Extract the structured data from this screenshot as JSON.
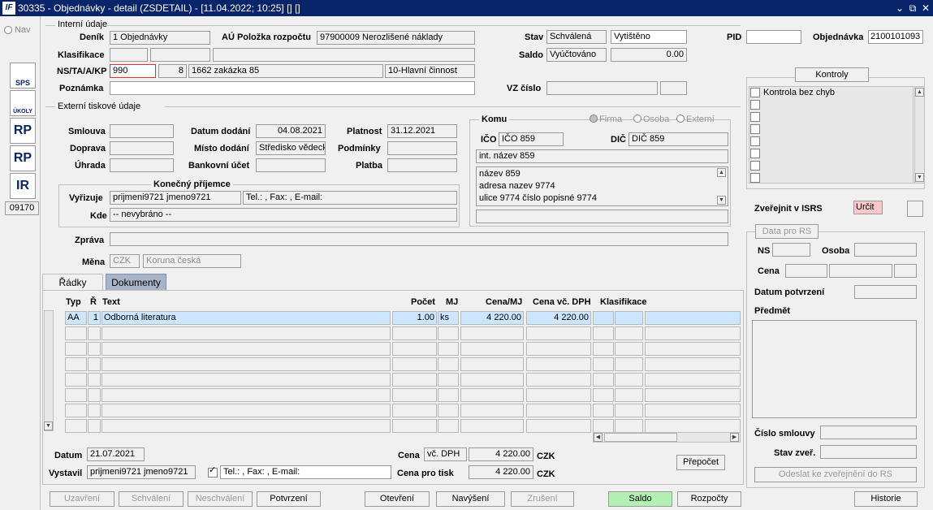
{
  "window": {
    "title": "30335 - Objednávky - detail (ZSDETAIL) - [11.04.2022; 10:25] [] []",
    "logo": "IF",
    "btn_min": "⌄",
    "btn_max": "⧉",
    "btn_close": "✕"
  },
  "nav": {
    "label": "Nav",
    "id_box": "09170",
    "icons": [
      {
        "name": "sps-icon",
        "text": "SPS"
      },
      {
        "name": "ukoly-icon",
        "text": "ÚKOLY"
      },
      {
        "name": "rp-cz-icon",
        "text": "RP"
      },
      {
        "name": "rp-eu-icon",
        "text": "RP"
      },
      {
        "name": "ir-cz-icon",
        "text": "IR"
      }
    ]
  },
  "internal": {
    "section": "Interní údaje",
    "denik_label": "Deník",
    "denik": "1 Objednávky",
    "au_label": "AÚ Položka rozpočtu",
    "au": "97900009 Nerozlišené náklady",
    "klas_label": "Klasifikace",
    "nsta_label": "NS/TA/A/KP",
    "ns": "990",
    "ta": "8",
    "zakazka": "1662 zakázka 85",
    "kp": "10-Hlavní činnost",
    "poznamka_label": "Poznámka",
    "stav_label": "Stav",
    "stav": "Schválená",
    "stav2": "Vytištěno",
    "saldo_label": "Saldo",
    "saldo": "Vyúčtováno",
    "saldo_val": "0.00",
    "vz_label": "VZ číslo",
    "pid_label": "PID",
    "obj_label": "Objednávka",
    "obj": "2100101093"
  },
  "external": {
    "section": "Externí tiskové údaje",
    "smlouva_label": "Smlouva",
    "doprava_label": "Doprava",
    "uhrada_label": "Úhrada",
    "datum_dodani_label": "Datum dodání",
    "datum_dodani": "04.08.2021",
    "misto_label": "Místo dodání",
    "misto": "Středisko vědeck",
    "bank_label": "Bankovní účet",
    "platnost_label": "Platnost",
    "platnost": "31.12.2021",
    "podminky_label": "Podmínky",
    "platba_label": "Platba",
    "prijemce_title": "Konečný příjemce",
    "vyrizuje_label": "Vyřizuje",
    "vyrizuje": "prijmeni9721 jmeno9721",
    "tel": "Tel.: , Fax: , E-mail:",
    "kde_label": "Kde",
    "kde": "-- nevybráno --",
    "zprava_label": "Zpráva",
    "mena_label": "Měna",
    "mena": "CZK",
    "mena_name": "Koruna česká"
  },
  "komu": {
    "title": "Komu",
    "radio_firma": "Firma",
    "radio_osoba": "Osoba",
    "radio_externi": "Externí",
    "ico_label": "IČO",
    "ico": "IČO 859",
    "dic_label": "DIČ",
    "dic": "DIČ 859",
    "int_name": "int. název 859",
    "addr1": "název 859",
    "addr2": "adresa nazev 9774",
    "addr3": "ulice 9774 číslo popisné 9774"
  },
  "kontroly": {
    "title": "Kontroly",
    "item1": "Kontrola bez chyb"
  },
  "isrs": {
    "label": "Zveřejnit v ISRS",
    "value": "Určit",
    "data_rs": "Data pro RS",
    "ns_label": "NS",
    "osoba_label": "Osoba",
    "cena_label": "Cena",
    "datum_potvrzeni_label": "Datum potvrzení",
    "predmet_label": "Předmět",
    "cislo_smlouvy_label": "Číslo smlouvy",
    "stav_zver_label": "Stav zveř.",
    "odeslat": "Odeslat ke zveřejnění do RS"
  },
  "tabs": {
    "radky": "Řádky",
    "dokumenty": "Dokumenty"
  },
  "table": {
    "headers": {
      "typ": "Typ",
      "r": "Ř",
      "text": "Text",
      "pocet": "Počet",
      "mj": "MJ",
      "cena_mj": "Cena/MJ",
      "cena_dph": "Cena vč. DPH",
      "klas": "Klasifikace"
    },
    "row1": {
      "typ": "AA",
      "r": "1",
      "text": "Odborná literatura",
      "pocet": "1.00",
      "mj": "ks",
      "cena_mj": "4 220.00",
      "cena_dph": "4 220.00"
    }
  },
  "footer": {
    "datum_label": "Datum",
    "datum": "21.07.2021",
    "vystavil_label": "Vystavil",
    "vystavil": "prijmeni9721 jmeno9721",
    "tel": "Tel.: , Fax: , E-mail:",
    "cena_label": "Cena",
    "cena_type": "vč. DPH",
    "cena_val": "4 220.00",
    "cena_cur": "CZK",
    "cena_tisk_label": "Cena pro tisk",
    "cena_tisk_val": "4 220.00",
    "cena_tisk_cur": "CZK",
    "prepocet": "Přepočet"
  },
  "buttons": {
    "uzavreni": "Uzavření",
    "schvaleni": "Schválení",
    "neschvaleni": "Neschválení",
    "potvrzeni": "Potvrzení",
    "otevreni": "Otevření",
    "navyseni": "Navýšení",
    "zruseni": "Zrušení",
    "saldo": "Saldo",
    "rozpocty": "Rozpočty",
    "historie": "Historie"
  }
}
